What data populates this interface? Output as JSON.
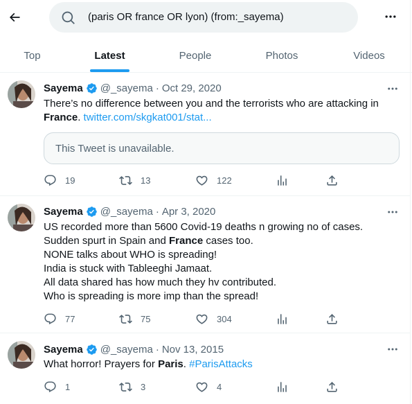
{
  "header": {
    "back_icon": "arrow-left-icon",
    "search_query": "(paris OR france OR lyon) (from:_sayema)",
    "more_icon": "more-icon"
  },
  "tabs": [
    {
      "label": "Top",
      "active": false
    },
    {
      "label": "Latest",
      "active": true
    },
    {
      "label": "People",
      "active": false
    },
    {
      "label": "Photos",
      "active": false
    },
    {
      "label": "Videos",
      "active": false
    }
  ],
  "colors": {
    "accent": "#1d9bf0",
    "muted": "#536471",
    "text": "#0f1419",
    "search_bg": "#eff3f4"
  },
  "tweets": [
    {
      "name": "Sayema",
      "handle": "@_sayema",
      "sep": "·",
      "date": "Oct 29, 2020",
      "text_pre": "There’s no difference between you and the terrorists who are attacking in",
      "text_bold": "France",
      "text_mid": ".",
      "link": "twitter.com/skgkat001/stat...",
      "quote": "This Tweet is unavailable.",
      "replies": "19",
      "retweets": "13",
      "likes": "122"
    },
    {
      "name": "Sayema",
      "handle": "@_sayema",
      "sep": "·",
      "date": "Apr 3, 2020",
      "line1": "US recorded more than 5600 Covid-19 deaths n growing no of cases.",
      "line2_pre": "Sudden spurt in Spain and",
      "line2_bold": "France",
      "line2_post": "cases too.",
      "line3": "NONE talks about WHO is spreading!",
      "line4": "India is stuck with Tableeghi Jamaat.",
      "line5": "All data shared has how much they hv contributed.",
      "line6": "Who is spreading is more imp than the spread!",
      "replies": "77",
      "retweets": "75",
      "likes": "304"
    },
    {
      "name": "Sayema",
      "handle": "@_sayema",
      "sep": "·",
      "date": "Nov 13, 2015",
      "text_pre": "What horror! Prayers for",
      "text_bold": "Paris",
      "text_mid": ".",
      "hashtag": "#ParisAttacks",
      "replies": "1",
      "retweets": "3",
      "likes": "4"
    }
  ]
}
